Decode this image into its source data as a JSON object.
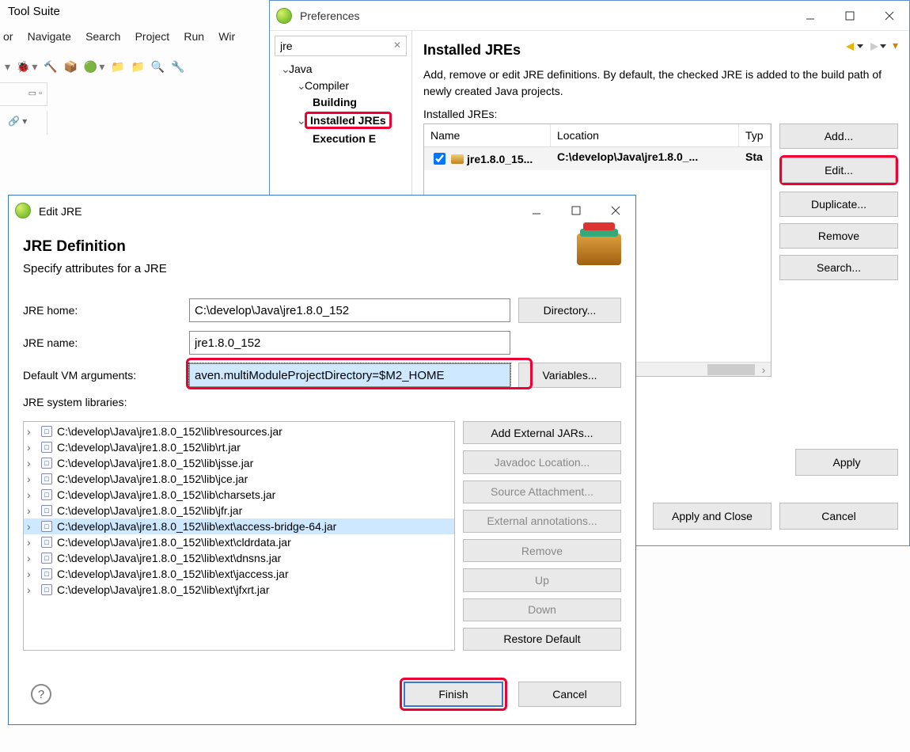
{
  "bg_window": {
    "title_fragment": "Tool Suite",
    "menu": [
      "or",
      "Navigate",
      "Search",
      "Project",
      "Run",
      "Wir"
    ]
  },
  "pref": {
    "title": "Preferences",
    "search": "jre",
    "tree": {
      "root": "Java",
      "compiler": "Compiler",
      "building": "Building",
      "installed": "Installed JREs",
      "execution": "Execution E"
    },
    "heading": "Installed JREs",
    "desc": "Add, remove or edit JRE definitions. By default, the checked JRE is added to the build path of newly created Java projects.",
    "list_label": "Installed JREs:",
    "cols": {
      "name": "Name",
      "location": "Location",
      "type": "Typ"
    },
    "row": {
      "name": "jre1.8.0_15...",
      "location": "C:\\develop\\Java\\jre1.8.0_...",
      "type": "Sta"
    },
    "btns": {
      "add": "Add...",
      "edit": "Edit...",
      "dup": "Duplicate...",
      "remove": "Remove",
      "search": "Search..."
    },
    "apply": "Apply",
    "apply_close": "Apply and Close",
    "cancel": "Cancel"
  },
  "dlg": {
    "title": "Edit JRE",
    "heading": "JRE Definition",
    "sub": "Specify attributes for a JRE",
    "labels": {
      "home": "JRE home:",
      "name": "JRE name:",
      "vmargs": "Default VM arguments:",
      "syslib": "JRE system libraries:"
    },
    "values": {
      "home": "C:\\develop\\Java\\jre1.8.0_152",
      "name": "jre1.8.0_152",
      "vmargs": "aven.multiModuleProjectDirectory=$M2_HOME"
    },
    "btns": {
      "directory": "Directory...",
      "variables": "Variables...",
      "addext": "Add External JARs...",
      "javadoc": "Javadoc Location...",
      "source": "Source Attachment...",
      "extann": "External annotations...",
      "remove": "Remove",
      "up": "Up",
      "down": "Down",
      "restore": "Restore Default",
      "finish": "Finish",
      "cancel": "Cancel"
    },
    "libs": [
      "C:\\develop\\Java\\jre1.8.0_152\\lib\\resources.jar",
      "C:\\develop\\Java\\jre1.8.0_152\\lib\\rt.jar",
      "C:\\develop\\Java\\jre1.8.0_152\\lib\\jsse.jar",
      "C:\\develop\\Java\\jre1.8.0_152\\lib\\jce.jar",
      "C:\\develop\\Java\\jre1.8.0_152\\lib\\charsets.jar",
      "C:\\develop\\Java\\jre1.8.0_152\\lib\\jfr.jar",
      "C:\\develop\\Java\\jre1.8.0_152\\lib\\ext\\access-bridge-64.jar",
      "C:\\develop\\Java\\jre1.8.0_152\\lib\\ext\\cldrdata.jar",
      "C:\\develop\\Java\\jre1.8.0_152\\lib\\ext\\dnsns.jar",
      "C:\\develop\\Java\\jre1.8.0_152\\lib\\ext\\jaccess.jar",
      "C:\\develop\\Java\\jre1.8.0_152\\lib\\ext\\jfxrt.jar"
    ],
    "selected_lib_index": 6
  }
}
